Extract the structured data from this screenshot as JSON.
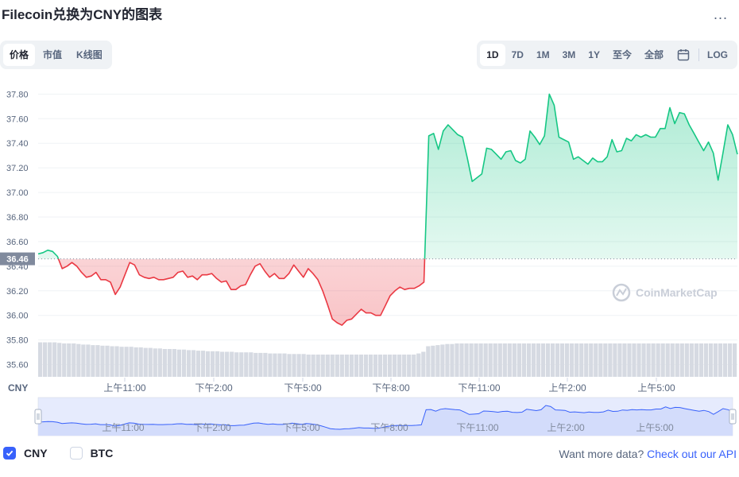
{
  "header": {
    "title": "Filecoin兑换为CNY的图表",
    "more_label": "..."
  },
  "tabs": [
    {
      "label": "价格",
      "active": true
    },
    {
      "label": "市值",
      "active": false
    },
    {
      "label": "K线图",
      "active": false
    }
  ],
  "ranges": [
    {
      "label": "1D",
      "active": true
    },
    {
      "label": "7D",
      "active": false
    },
    {
      "label": "1M",
      "active": false
    },
    {
      "label": "3M",
      "active": false
    },
    {
      "label": "1Y",
      "active": false
    },
    {
      "label": "至今",
      "active": false
    },
    {
      "label": "全部",
      "active": false
    }
  ],
  "log_label": "LOG",
  "icons": {
    "calendar": "calendar-icon",
    "more": "more-horizontal-icon",
    "check": "check-icon",
    "watermark": "coinmarketcap-logo"
  },
  "footer": {
    "currencies": [
      {
        "label": "CNY",
        "checked": true
      },
      {
        "label": "BTC",
        "checked": false
      }
    ],
    "promo_text": "Want more data?",
    "promo_link": "Check out our API"
  },
  "colors": {
    "up": "#16c784",
    "down": "#ea3943",
    "accent": "#3861fb",
    "grid": "#eff2f5",
    "text_muted": "#58667e"
  },
  "chart_data": {
    "type": "line",
    "ylabel": "",
    "currency_label": "CNY",
    "ylim": [
      35.5,
      37.88
    ],
    "yticks": [
      "37.80",
      "37.60",
      "37.40",
      "37.20",
      "37.00",
      "36.80",
      "36.60",
      "36.40",
      "36.20",
      "36.00",
      "35.80",
      "35.60"
    ],
    "xticks": [
      "上午11:00",
      "下午2:00",
      "下午5:00",
      "下午8:00",
      "下午11:00",
      "上午2:00",
      "上午5:00"
    ],
    "reference_price": 36.46,
    "reference_label": "36.46",
    "watermark": "CoinMarketCap",
    "grid": true,
    "series": [
      {
        "values": [
          36.5,
          36.51,
          36.53,
          36.52,
          36.48,
          36.38,
          36.4,
          36.43,
          36.4,
          36.35,
          36.31,
          36.32,
          36.35,
          36.29,
          36.29,
          36.27,
          36.17,
          36.23,
          36.33,
          36.43,
          36.41,
          36.33,
          36.31,
          36.3,
          36.31,
          36.29,
          36.29,
          36.3,
          36.31,
          36.35,
          36.36,
          36.31,
          36.32,
          36.29,
          36.33,
          36.33,
          36.34,
          36.3,
          36.27,
          36.28,
          36.21,
          36.21,
          36.24,
          36.25,
          36.33,
          36.4,
          36.42,
          36.36,
          36.31,
          36.34,
          36.3,
          36.3,
          36.34,
          36.41,
          36.36,
          36.31,
          36.38,
          36.34,
          36.29,
          36.2,
          36.09,
          35.97,
          35.94,
          35.92,
          35.96,
          35.97,
          36.01,
          36.05,
          36.02,
          36.02,
          36.0,
          36.0,
          36.08,
          36.16,
          36.2,
          36.23,
          36.21,
          36.22,
          36.22,
          36.24,
          36.27,
          37.46,
          37.48,
          37.35,
          37.5,
          37.55,
          37.51,
          37.47,
          37.45,
          37.28,
          37.09,
          37.12,
          37.15,
          37.36,
          37.35,
          37.31,
          37.27,
          37.33,
          37.34,
          37.26,
          37.24,
          37.27,
          37.5,
          37.45,
          37.39,
          37.46,
          37.8,
          37.71,
          37.45,
          37.43,
          37.41,
          37.27,
          37.29,
          37.26,
          37.23,
          37.28,
          37.25,
          37.25,
          37.29,
          37.43,
          37.33,
          37.34,
          37.44,
          37.42,
          37.47,
          37.45,
          37.47,
          37.45,
          37.45,
          37.52,
          37.52,
          37.69,
          37.56,
          37.65,
          37.64,
          37.55,
          37.48,
          37.41,
          37.34,
          37.41,
          37.32,
          37.1,
          37.32,
          37.55,
          37.47,
          37.31
        ]
      }
    ],
    "volume_values": [
      0.62,
      0.62,
      0.62,
      0.62,
      0.61,
      0.6,
      0.6,
      0.6,
      0.59,
      0.58,
      0.58,
      0.57,
      0.57,
      0.56,
      0.56,
      0.55,
      0.55,
      0.54,
      0.54,
      0.54,
      0.53,
      0.53,
      0.52,
      0.52,
      0.51,
      0.51,
      0.5,
      0.5,
      0.5,
      0.49,
      0.49,
      0.48,
      0.48,
      0.47,
      0.47,
      0.46,
      0.46,
      0.46,
      0.45,
      0.45,
      0.45,
      0.44,
      0.44,
      0.44,
      0.44,
      0.43,
      0.43,
      0.43,
      0.42,
      0.42,
      0.42,
      0.42,
      0.41,
      0.41,
      0.41,
      0.41,
      0.4,
      0.4,
      0.4,
      0.4,
      0.4,
      0.4,
      0.4,
      0.4,
      0.4,
      0.4,
      0.4,
      0.4,
      0.4,
      0.4,
      0.4,
      0.4,
      0.4,
      0.4,
      0.4,
      0.4,
      0.4,
      0.4,
      0.4,
      0.42,
      0.45,
      0.55,
      0.56,
      0.57,
      0.58,
      0.59,
      0.59,
      0.6,
      0.6,
      0.6,
      0.6,
      0.6,
      0.6,
      0.6,
      0.6,
      0.6,
      0.6,
      0.6,
      0.6,
      0.6,
      0.6,
      0.6,
      0.6,
      0.6,
      0.6,
      0.6,
      0.6,
      0.6,
      0.6,
      0.6,
      0.6,
      0.6,
      0.6,
      0.6,
      0.6,
      0.6,
      0.6,
      0.6,
      0.6,
      0.6,
      0.6,
      0.6,
      0.6,
      0.6,
      0.6,
      0.6,
      0.6,
      0.6,
      0.6,
      0.6,
      0.6,
      0.6,
      0.6,
      0.6,
      0.6,
      0.6,
      0.6,
      0.6,
      0.6,
      0.6,
      0.6,
      0.6,
      0.6,
      0.6,
      0.6,
      0.6
    ]
  }
}
